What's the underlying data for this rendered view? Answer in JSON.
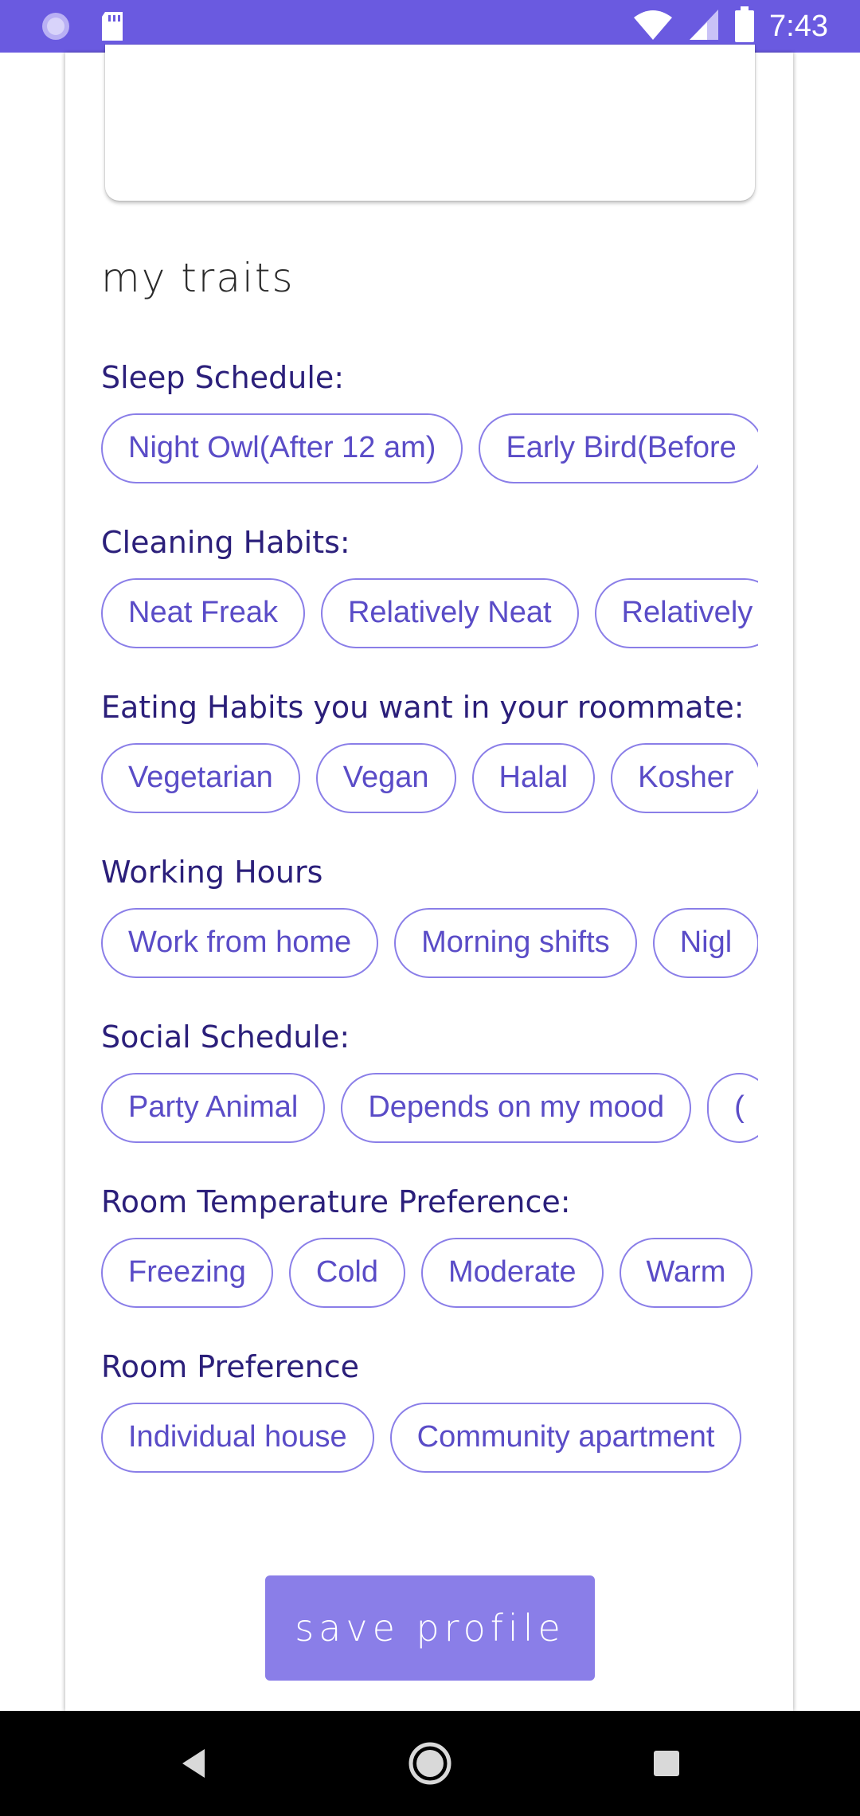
{
  "status_bar": {
    "time": "7:43",
    "icons": [
      "loading-icon",
      "sd-card-icon",
      "wifi-icon",
      "signal-icon",
      "battery-icon"
    ]
  },
  "profile": {
    "section_title": "my traits",
    "traits": [
      {
        "label": "Sleep Schedule:",
        "options": [
          "Night Owl(After 12 am)",
          "Early Bird(Before"
        ]
      },
      {
        "label": "Cleaning Habits:",
        "options": [
          "Neat Freak",
          "Relatively Neat",
          "Relatively"
        ]
      },
      {
        "label": "Eating Habits you want in your roommate:",
        "options": [
          "Vegetarian",
          "Vegan",
          "Halal",
          "Kosher"
        ]
      },
      {
        "label": "Working Hours",
        "options": [
          "Work from home",
          "Morning shifts",
          "Nigl"
        ]
      },
      {
        "label": "Social Schedule:",
        "options": [
          "Party Animal",
          "Depends on my mood",
          "("
        ]
      },
      {
        "label": "Room Temperature Preference:",
        "options": [
          "Freezing",
          "Cold",
          "Moderate",
          "Warm"
        ]
      },
      {
        "label": "Room Preference",
        "options": [
          "Individual house",
          "Community apartment"
        ]
      }
    ],
    "save_label": "save profile"
  },
  "nav_bar": {
    "buttons": [
      "back-icon",
      "home-icon",
      "recents-icon"
    ]
  },
  "colors": {
    "status_bar": "#6a5ae0",
    "accent": "#8a7ee8",
    "chip_text": "#5a4cc7",
    "label_text": "#2b1f7a"
  }
}
